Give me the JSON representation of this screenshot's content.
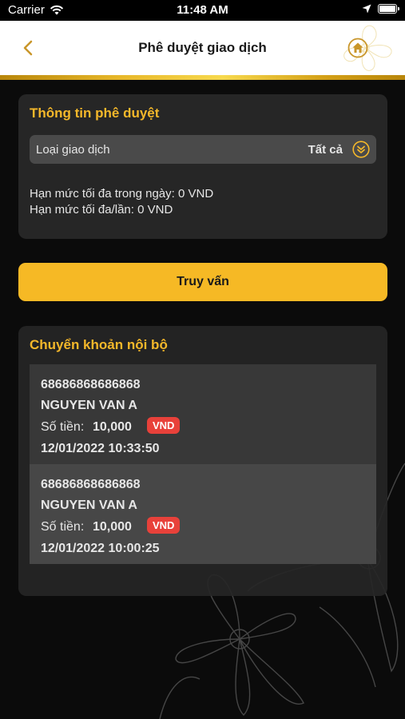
{
  "status_bar": {
    "carrier": "Carrier",
    "time": "11:48 AM"
  },
  "header": {
    "title": "Phê duyệt giao dịch"
  },
  "approval_info": {
    "title": "Thông tin phê duyệt",
    "transaction_type": {
      "label": "Loại giao dịch",
      "value": "Tất cả"
    },
    "daily_limit": "Hạn mức tối đa trong ngày: 0 VND",
    "per_transaction_limit": "Hạn mức tối đa/lần: 0 VND"
  },
  "query_button": {
    "label": "Truy vấn"
  },
  "internal_transfer": {
    "title": "Chuyển khoản nội bộ",
    "transactions": [
      {
        "account": "68686868686868",
        "name": "NGUYEN VAN A",
        "amount_label": "Số tiền:",
        "amount": "10,000",
        "currency": "VND",
        "datetime": "12/01/2022 10:33:50"
      },
      {
        "account": "68686868686868",
        "name": "NGUYEN VAN A",
        "amount_label": "Số tiền:",
        "amount": "10,000",
        "currency": "VND",
        "datetime": "12/01/2022 10:00:25"
      }
    ]
  },
  "colors": {
    "accent": "#f6b925",
    "title_gold": "#f5b82a",
    "badge_red": "#e8413a",
    "card_bg": "#262626"
  },
  "icons": [
    "wifi-icon",
    "location-icon",
    "battery-icon",
    "back-icon",
    "home-icon",
    "double-chevron-down-icon"
  ]
}
